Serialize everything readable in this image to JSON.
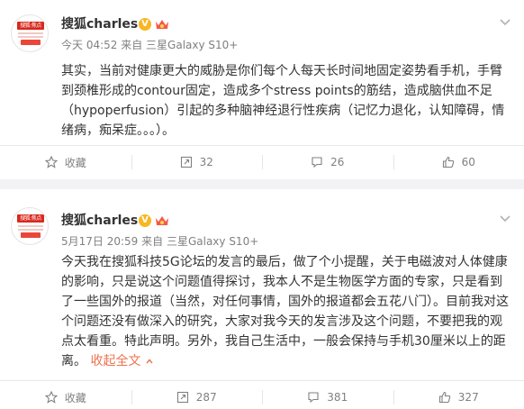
{
  "posts": [
    {
      "author": "搜狐charles",
      "avatar_text": "搜狐·焦点",
      "verified_badge": "V",
      "time": "今天 04:52",
      "source": "来自 三星Galaxy S10+",
      "text": "其实，当前对健康更大的威胁是你们每个人每天长时间地固定姿势看手机，手臂到颈椎形成的contour固定，造成多个stress points的筋结，造成脑供血不足（hypoperfusion）引起的多种脑神经退行性疾病（记忆力退化，认知障碍，情绪病，痴呆症。。。）。",
      "actions": {
        "favorite": "收藏",
        "repost_count": "32",
        "comment_count": "26",
        "like_count": "60"
      }
    },
    {
      "author": "搜狐charles",
      "avatar_text": "搜狐·焦点",
      "verified_badge": "V",
      "time": "5月17日 20:59",
      "source": "来自 三星Galaxy S10+",
      "text": "今天我在搜狐科技5G论坛的发言的最后，做了个小提醒，关于电磁波对人体健康的影响，只是说这个问题值得探讨，我本人不是生物医学方面的专家，只是看到了一些国外的报道（当然，对任何事情，国外的报道都会五花八门）。目前我对这个问题还没有做深入的研究，大家对我今天的发言涉及这个问题，不要把我的观点太看重。特此声明。另外，我自己生活中，一般会保持与手机30厘米以上的距离。",
      "collapse_label": "收起全文",
      "actions": {
        "favorite": "收藏",
        "repost_count": "287",
        "comment_count": "381",
        "like_count": "327"
      }
    }
  ],
  "colors": {
    "accent": "#eb7350",
    "verified": "#f8b621",
    "muted": "#808080"
  }
}
